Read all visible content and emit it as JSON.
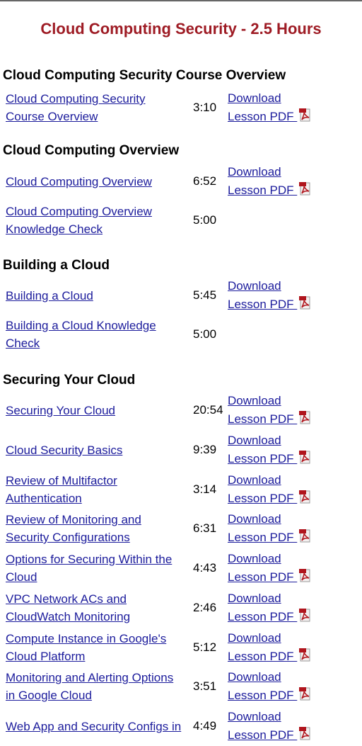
{
  "page": {
    "title": "Cloud Computing Security - 2.5 Hours"
  },
  "colors": {
    "title": "#9e1b24",
    "link": "#1c1c9c",
    "pdf_icon": "#b0151d"
  },
  "download_label_line1": "Download",
  "download_label_line2": "Lesson PDF",
  "sections": [
    {
      "heading": "Cloud Computing Security Course Overview",
      "lessons": [
        {
          "title_line1": "Cloud Computing Security",
          "title_line2": "Course Overview",
          "duration": "3:10",
          "has_pdf": true
        }
      ]
    },
    {
      "heading": "Cloud Computing Overview",
      "lessons": [
        {
          "title_line1": "Cloud Computing Overview",
          "title_line2": "",
          "duration": "6:52",
          "has_pdf": true
        },
        {
          "title_line1": "Cloud Computing Overview",
          "title_line2": "Knowledge Check",
          "duration": "5:00",
          "has_pdf": false
        }
      ]
    },
    {
      "heading": "Building a Cloud",
      "lessons": [
        {
          "title_line1": "Building a Cloud",
          "title_line2": "",
          "duration": "5:45",
          "has_pdf": true
        },
        {
          "title_line1": "Building a Cloud Knowledge",
          "title_line2": "Check",
          "duration": "5:00",
          "has_pdf": false
        }
      ]
    },
    {
      "heading": "Securing Your Cloud",
      "lessons": [
        {
          "title_line1": "Securing Your Cloud",
          "title_line2": "",
          "duration": "20:54",
          "has_pdf": true
        },
        {
          "title_line1": "Cloud Security Basics",
          "title_line2": "",
          "duration": "9:39",
          "has_pdf": true
        },
        {
          "title_line1": "Review of Multifactor",
          "title_line2": "Authentication",
          "duration": "3:14",
          "has_pdf": true
        },
        {
          "title_line1": "Review of Monitoring and",
          "title_line2": "Security Configurations",
          "duration": "6:31",
          "has_pdf": true
        },
        {
          "title_line1": "Options for Securing Within the",
          "title_line2": "Cloud",
          "duration": "4:43",
          "has_pdf": true
        },
        {
          "title_line1": "VPC Network ACs and",
          "title_line2": "CloudWatch Monitoring",
          "duration": "2:46",
          "has_pdf": true
        },
        {
          "title_line1": "Compute Instance in Google's",
          "title_line2": "Cloud Platform",
          "duration": "5:12",
          "has_pdf": true
        },
        {
          "title_line1": "Monitoring and Alerting Options",
          "title_line2": "in Google Cloud",
          "duration": "3:51",
          "has_pdf": true
        },
        {
          "title_line1": "Web App and Security Configs in",
          "title_line2": "",
          "duration": "4:49",
          "has_pdf": true
        }
      ]
    }
  ]
}
